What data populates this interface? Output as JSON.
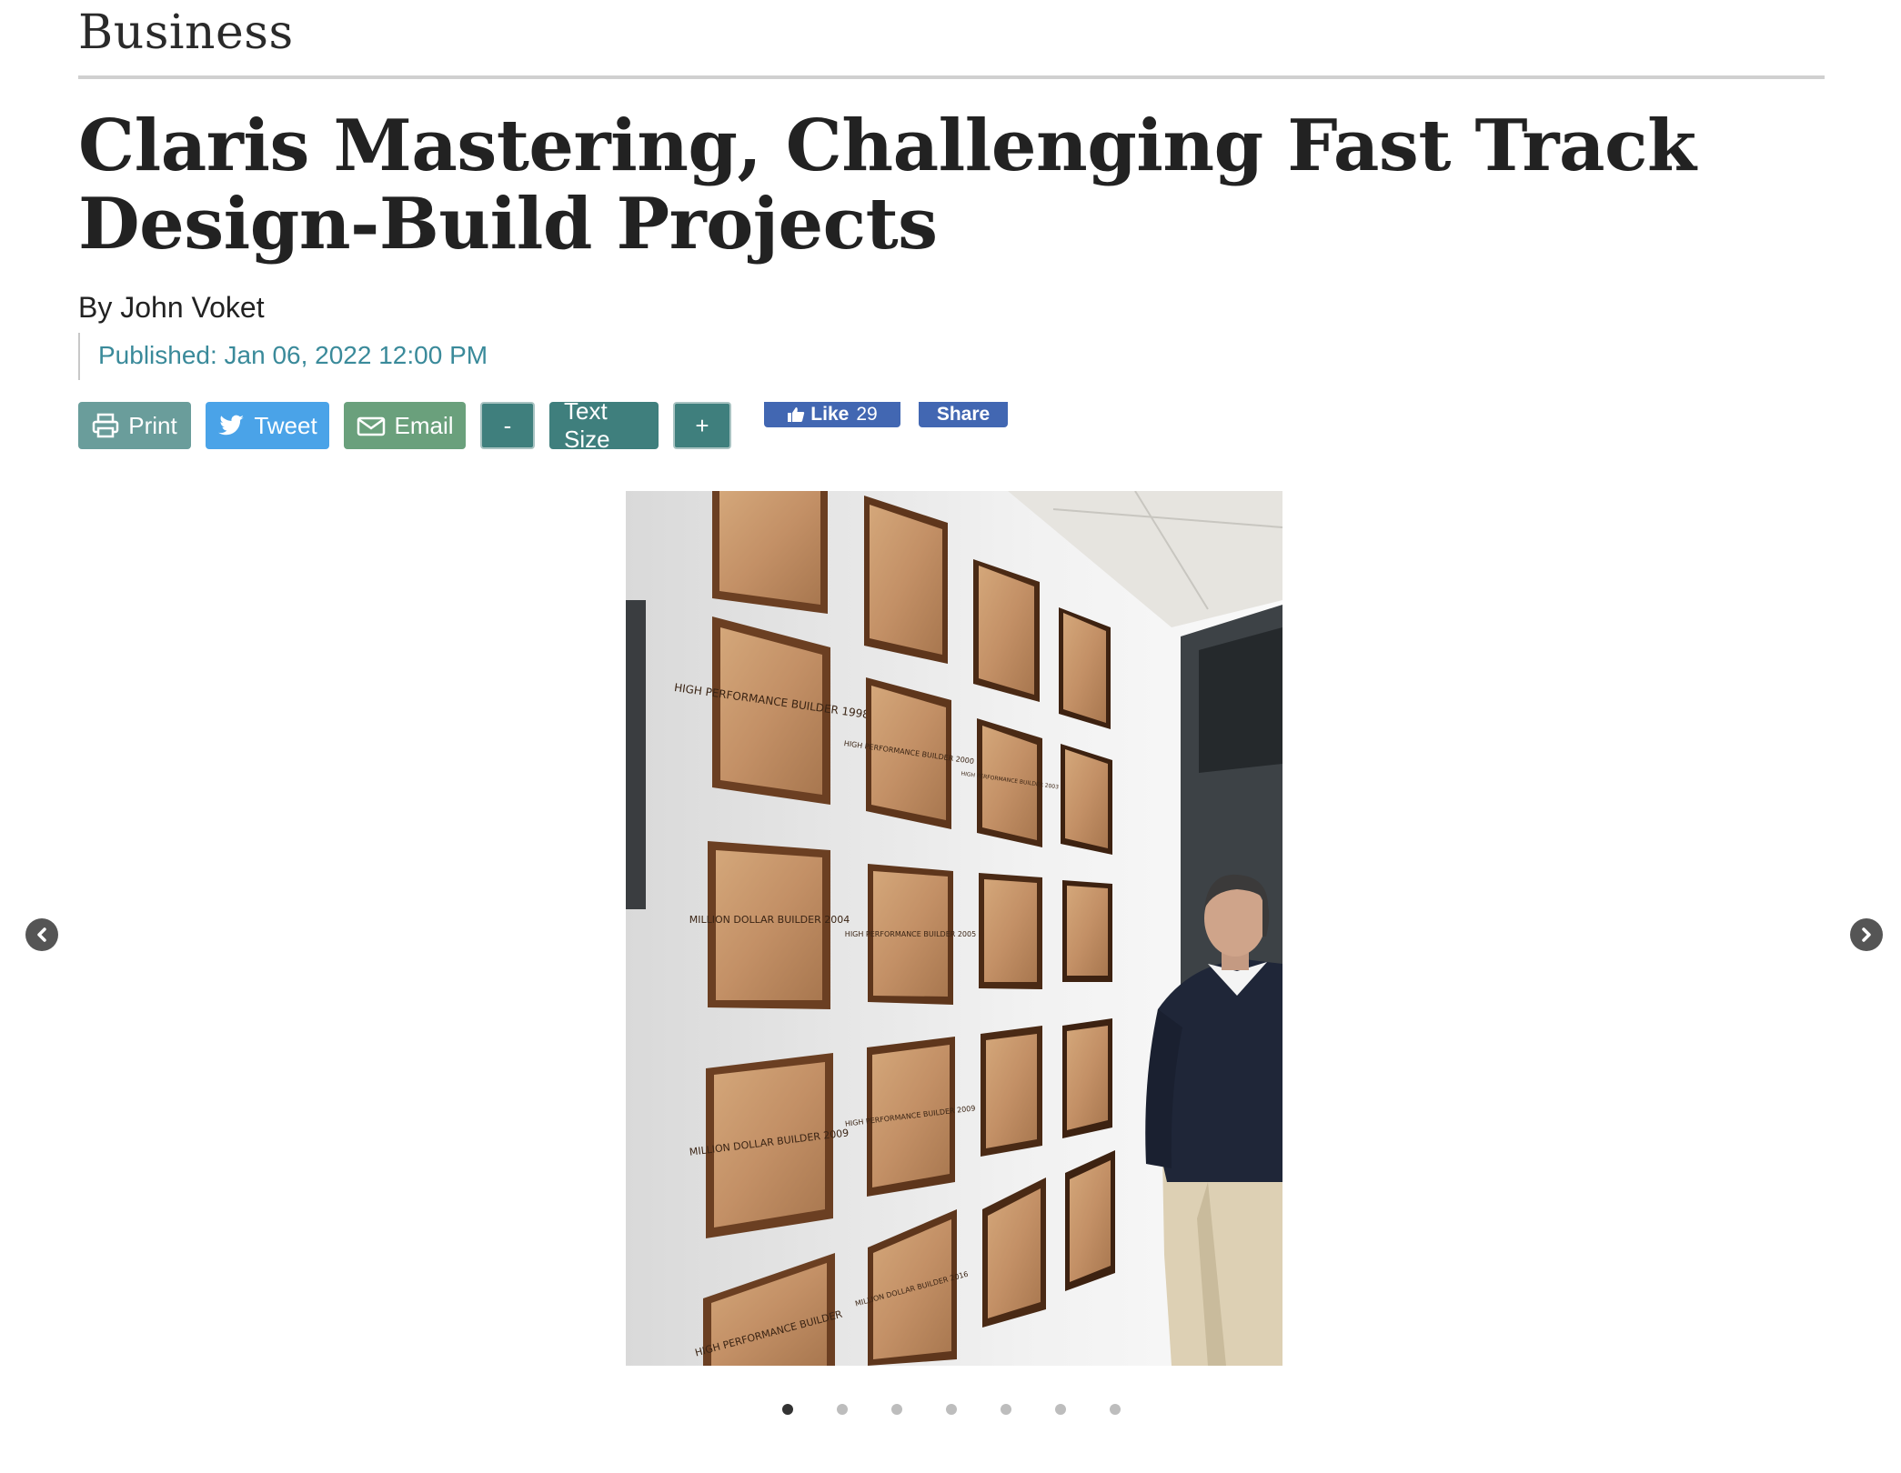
{
  "section": {
    "label": "Business"
  },
  "article": {
    "headline": "Claris Mastering, Challenging Fast Track Design-Build Projects",
    "byline": "By John Voket",
    "published": "Published: Jan 06, 2022 12:00 PM"
  },
  "toolbar": {
    "print_label": "Print",
    "tweet_label": "Tweet",
    "email_label": "Email",
    "text_smaller_label": "-",
    "text_size_label": "Text Size",
    "text_larger_label": "+"
  },
  "facebook": {
    "like_label": "Like",
    "like_count": "29",
    "share_label": "Share"
  },
  "gallery": {
    "slide_count": 7,
    "active_index": 0
  },
  "plaques": {
    "r1c1": "HIGH PERFORMANCE BUILDER 1998",
    "r1c2": "HIGH PERFORMANCE BUILDER 2000",
    "r1c3": "HIGH PERFORMANCE BUILDER 2003",
    "r2c1": "MILLION DOLLAR BUILDER 2004",
    "r2c2": "HIGH PERFORMANCE BUILDER 2005",
    "r3c1": "MILLION DOLLAR BUILDER 2009",
    "r3c2": "HIGH PERFORMANCE BUILDER 2009",
    "r4c2": "MILLION DOLLAR BUILDER 2016",
    "r4c1": "HIGH PERFORMANCE BUILDER"
  },
  "colors": {
    "published_text": "#3a8a9a",
    "print_button": "#6a9d9b",
    "tweet_button": "#4aa3e8",
    "email_button": "#6aa07c",
    "text_size_buttons": "#3f7f7d",
    "facebook": "#4267b2"
  },
  "icons": {
    "print": "printer-icon",
    "tweet": "twitter-bird-icon",
    "email": "envelope-icon",
    "like": "thumbs-up-icon",
    "prev": "chevron-left-icon",
    "next": "chevron-right-icon"
  }
}
